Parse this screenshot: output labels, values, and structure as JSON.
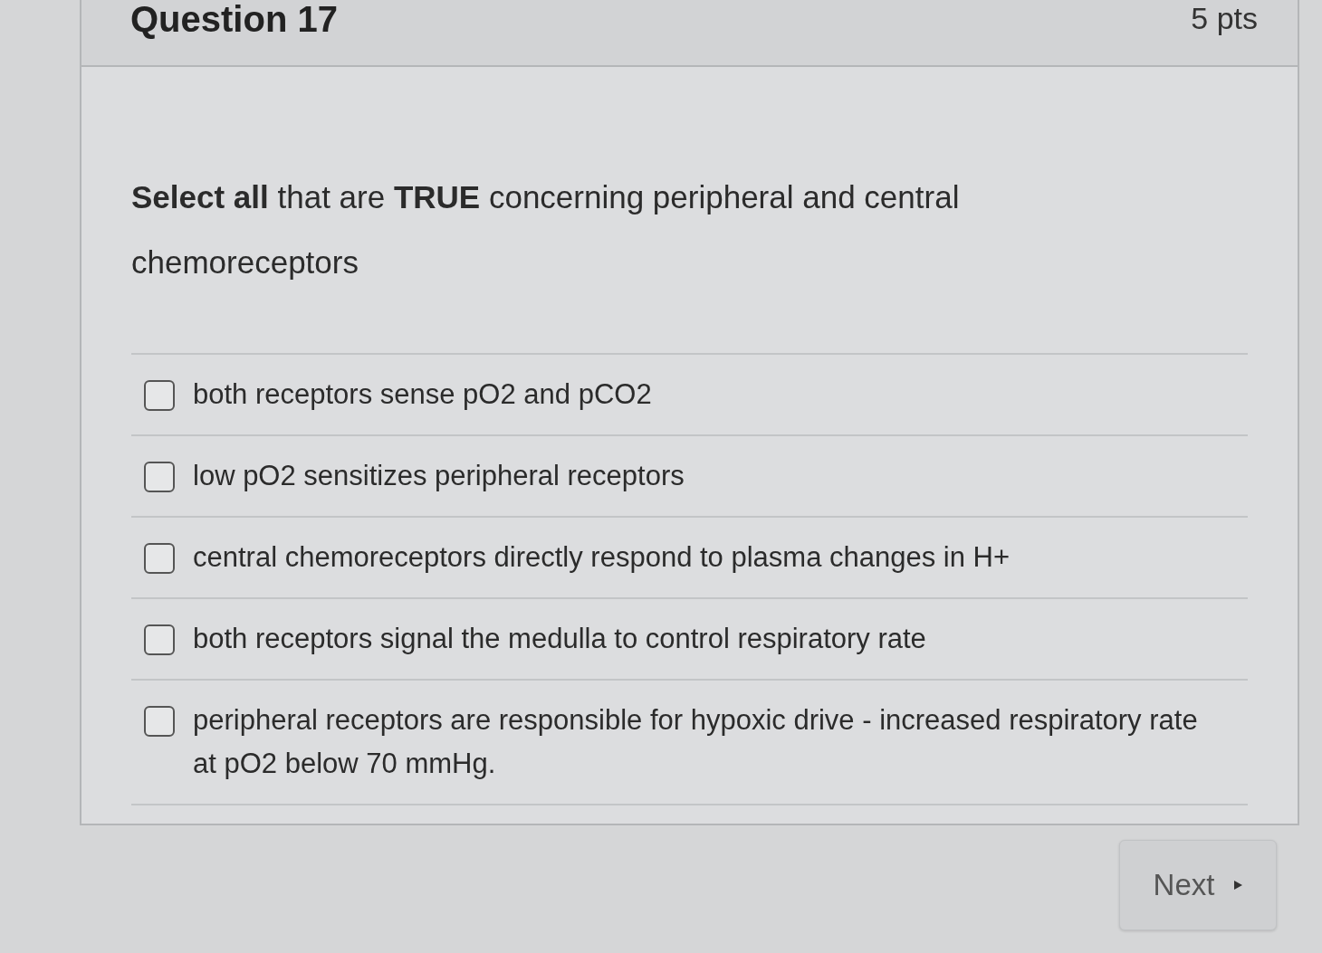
{
  "header": {
    "title": "Question 17",
    "points": "5 pts"
  },
  "question": {
    "text": "**Select all** that are **TRUE** concerning peripheral and central chemoreceptors"
  },
  "answers": [
    {
      "label": "both receptors sense pO2 and pCO2",
      "checked": false
    },
    {
      "label": "low pO2 sensitizes peripheral receptors",
      "checked": false
    },
    {
      "label": "central chemoreceptors directly respond to plasma changes in H+",
      "checked": false
    },
    {
      "label": "both receptors signal the medulla to control respiratory rate",
      "checked": false
    },
    {
      "label": "peripheral receptors are responsible for hypoxic drive - increased respiratory rate at pO2 below 70 mmHg.",
      "checked": false
    }
  ],
  "next_button": {
    "label": "Next"
  }
}
